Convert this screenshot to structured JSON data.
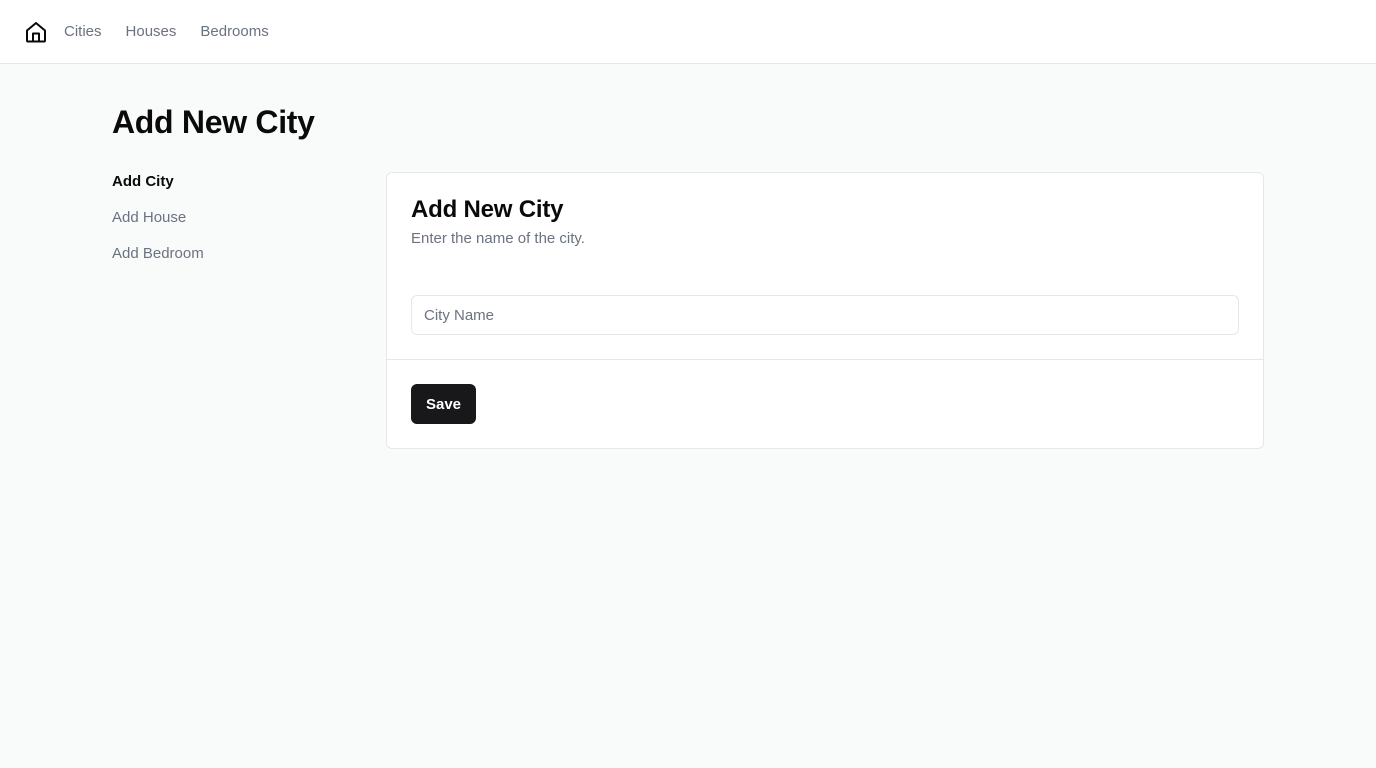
{
  "header": {
    "home_icon": "home-icon",
    "nav": [
      {
        "label": "Cities"
      },
      {
        "label": "Houses"
      },
      {
        "label": "Bedrooms"
      }
    ]
  },
  "page": {
    "title": "Add New City"
  },
  "sidebar": {
    "items": [
      {
        "label": "Add City",
        "active": true
      },
      {
        "label": "Add House",
        "active": false
      },
      {
        "label": "Add Bedroom",
        "active": false
      }
    ]
  },
  "card": {
    "title": "Add New City",
    "description": "Enter the name of the city.",
    "city_input": {
      "value": "",
      "placeholder": "City Name"
    },
    "save_label": "Save"
  },
  "colors": {
    "background": "#f9fafa",
    "surface": "#ffffff",
    "border": "#e5e7eb",
    "muted_text": "#6b7280",
    "primary_button": "#18181b"
  }
}
